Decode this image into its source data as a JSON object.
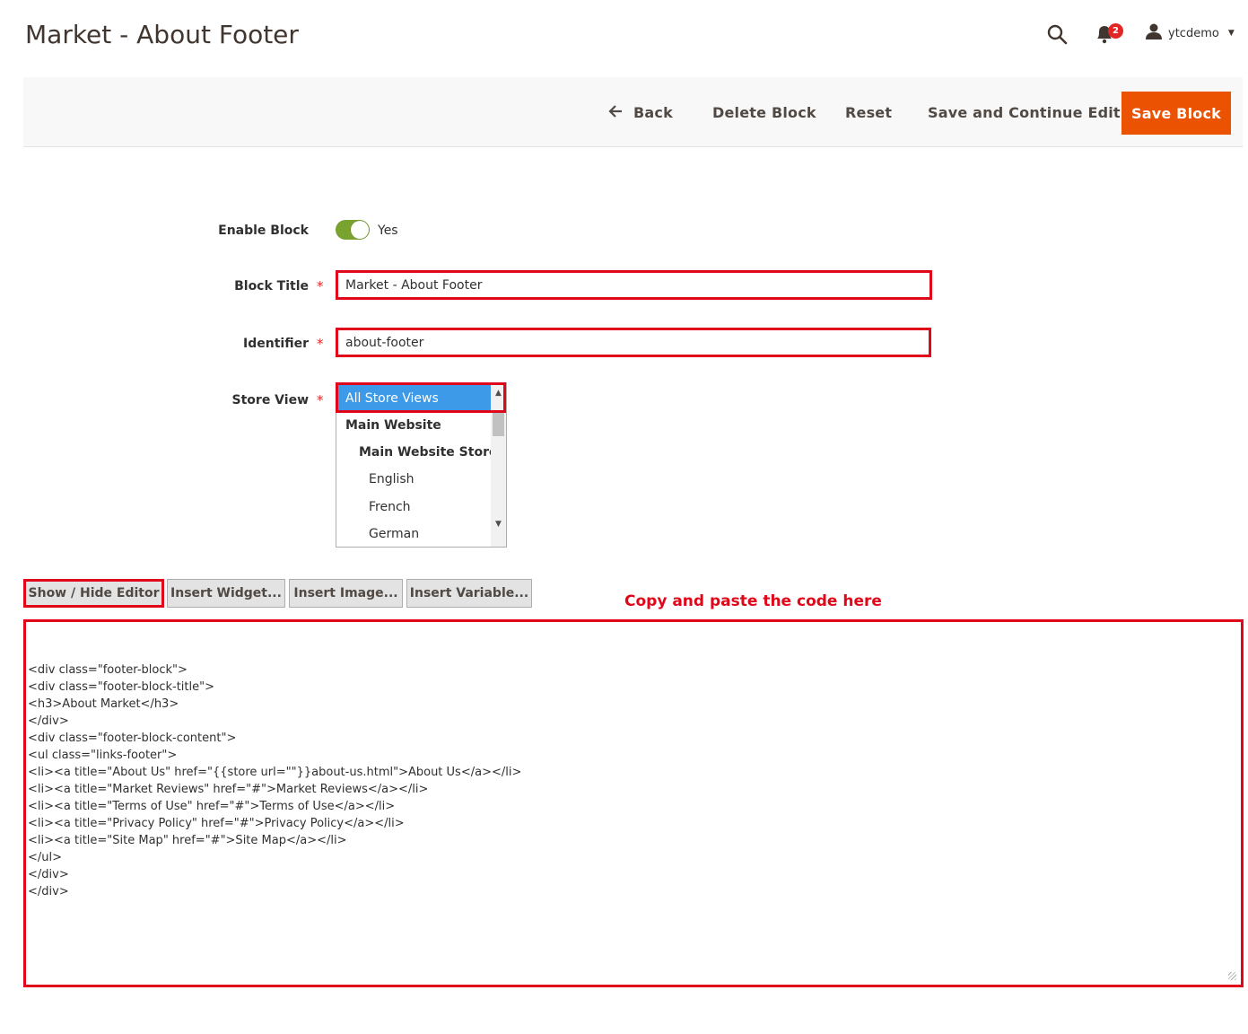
{
  "header": {
    "title": "Market - About Footer",
    "notifications_count": "2",
    "username": "ytcdemo"
  },
  "action_bar": {
    "back": "Back",
    "delete": "Delete Block",
    "reset": "Reset",
    "save_continue": "Save and Continue Edit",
    "save": "Save Block"
  },
  "form": {
    "enable_block": {
      "label": "Enable Block",
      "value": "Yes"
    },
    "block_title": {
      "label": "Block Title",
      "value": "Market - About Footer"
    },
    "identifier": {
      "label": "Identifier",
      "value": "about-footer"
    },
    "store_view": {
      "label": "Store View",
      "options": [
        "All Store Views",
        "Main Website",
        "Main Website Store",
        "English",
        "French",
        "German"
      ],
      "selected": "All Store Views"
    }
  },
  "editor": {
    "buttons": {
      "show_hide": "Show / Hide Editor",
      "insert_widget": "Insert Widget...",
      "insert_image": "Insert Image...",
      "insert_variable": "Insert Variable..."
    },
    "annotation": "Copy and paste the code here",
    "code_lines": [
      "<div class=\"footer-block\">",
      "<div class=\"footer-block-title\">",
      "<h3>About Market</h3>",
      "</div>",
      "<div class=\"footer-block-content\">",
      "<ul class=\"links-footer\">",
      "<li><a title=\"About Us\" href=\"{{store url=\"\"}}about-us.html\">About Us</a></li>",
      "<li><a title=\"Market Reviews\" href=\"#\">Market Reviews</a></li>",
      "<li><a title=\"Terms of Use\" href=\"#\">Terms of Use</a></li>",
      "<li><a title=\"Privacy Policy\" href=\"#\">Privacy Policy</a></li>",
      "<li><a title=\"Site Map\" href=\"#\">Site Map</a></li>",
      "</ul>",
      "</div>",
      "</div>"
    ]
  },
  "colors": {
    "primary_button": "#eb5202",
    "highlight_outline": "#e0071b",
    "toggle_on": "#79a22e",
    "selected_option": "#3d9ae8"
  },
  "icons": [
    "search-icon",
    "bell-icon",
    "user-icon",
    "arrow-left-icon",
    "chevron-up-icon",
    "chevron-down-icon"
  ]
}
